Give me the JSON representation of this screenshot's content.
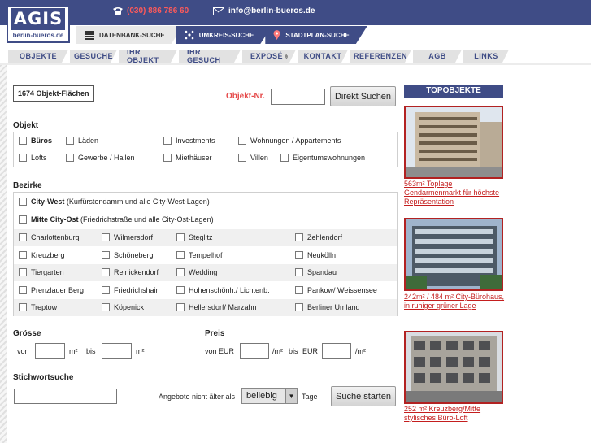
{
  "logo": {
    "main": "AGIS",
    "sub": "berlin-bueros.de"
  },
  "contact": {
    "phone": "(030) 886 786 60",
    "email": "info@berlin-bueros.de"
  },
  "search_tabs": [
    {
      "label": "DATENBANK-SUCHE",
      "icon": "list-icon",
      "active": true
    },
    {
      "label": "UMKREIS-SUCHE",
      "icon": "radius-icon",
      "active": false
    },
    {
      "label": "STADTPLAN-SUCHE",
      "icon": "map-pin-icon",
      "active": false
    }
  ],
  "nav": [
    "OBJEKTE",
    "GESUCHE",
    "IHR OBJEKT",
    "IHR GESUCH",
    "EXPOSÉ",
    "KONTAKT",
    "REFERENZEN",
    "AGB",
    "LINKS"
  ],
  "form": {
    "count": "1674 Objekt-Flächen",
    "objnr_label": "Objekt-Nr.",
    "direct_button": "Direkt Suchen",
    "objekt_title": "Objekt",
    "objekt_options": [
      "Büros",
      "Läden",
      "Investments",
      "Wohnungen / Appartements",
      "Lofts",
      "Gewerbe / Hallen",
      "Miethäuser",
      "Villen",
      "Eigentumswohnungen"
    ],
    "bezirke_title": "Bezirke",
    "city_west": {
      "name": "City-West",
      "desc": "(Kurfürstendamm und alle City-West-Lagen)"
    },
    "city_ost": {
      "name": "Mitte City-Ost",
      "desc": "(Friedrichstraße und alle City-Ost-Lagen)"
    },
    "bezirke": [
      [
        "Charlottenburg",
        "Wilmersdorf",
        "Steglitz",
        "Zehlendorf"
      ],
      [
        "Kreuzberg",
        "Schöneberg",
        "Tempelhof",
        "Neukölln"
      ],
      [
        "Tiergarten",
        "Reinickendorf",
        "Wedding",
        "Spandau"
      ],
      [
        "Prenzlauer Berg",
        "Friedrichshain",
        "Hohenschönh./ Lichtenb.",
        "Pankow/ Weissensee"
      ],
      [
        "Treptow",
        "Köpenick",
        "Hellersdorf/ Marzahn",
        "Berliner Umland"
      ]
    ],
    "groesse_title": "Grösse",
    "von": "von",
    "bis": "bis",
    "m2": "m²",
    "preis_title": "Preis",
    "von_eur": "von EUR",
    "per_m2": "/m²",
    "eur": "EUR",
    "stichwort_title": "Stichwortsuche",
    "angebote_label": "Angebote nicht älter als",
    "age_select": "beliebig",
    "tage": "Tage",
    "search_button": "Suche starten"
  },
  "topobjekte": {
    "title": "TOPOBJEKTE",
    "items": [
      {
        "text": "563m² Toplage Gendarmenmarkt für höchste Repräsentation"
      },
      {
        "text": "242m² / 484 m² City-Bürohaus, in ruhiger grüner Lage"
      },
      {
        "text": "252 m² Kreuzberg/Mitte stylisches Büro-Loft"
      }
    ]
  }
}
